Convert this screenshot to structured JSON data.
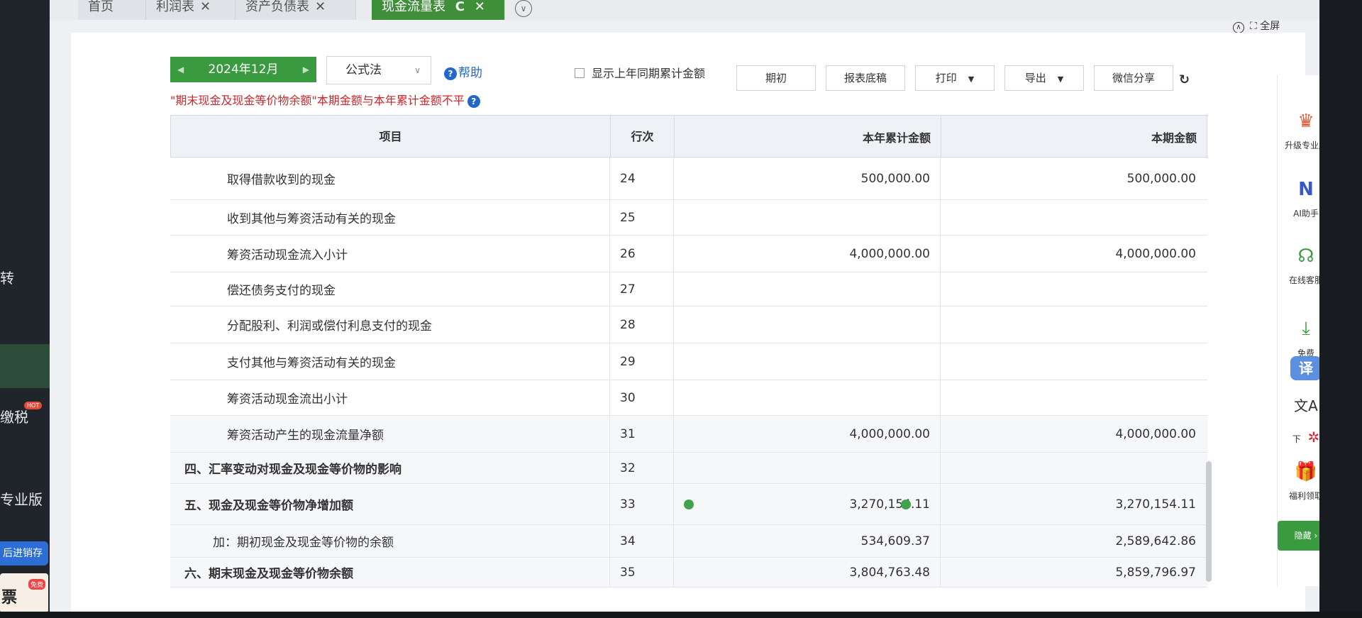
{
  "tabs": [
    {
      "label": "首页",
      "closable": false,
      "active": false
    },
    {
      "label": "利润表",
      "closable": true,
      "active": false
    },
    {
      "label": "资产负债表",
      "closable": true,
      "active": false
    },
    {
      "label": "现金流量表",
      "closable": true,
      "active": true
    }
  ],
  "tab_close_glyph": "✕",
  "tab_refresh_glyph": "C",
  "fullscreen_label": "全屏",
  "left_strip": {
    "item_1": "转",
    "item_2": "缴税",
    "hot_badge": "HOT",
    "item_3": "专业版",
    "blue_button": "后进销存",
    "card_text": "票",
    "card_badge": "免费"
  },
  "toolbar": {
    "period": "2024年12月",
    "method": "公式法",
    "help": "帮助",
    "show_last_year": "显示上年同期累计金额",
    "btn_opening": "期初",
    "btn_draft": "报表底稿",
    "btn_print": "打印",
    "btn_export": "导出",
    "btn_wechat": "微信分享"
  },
  "warning": "\"期末现金及现金等价物余额\"本期金额与本年累计金额不平",
  "table": {
    "headers": {
      "item": "项目",
      "line": "行次",
      "ytd": "本年累计金额",
      "period": "本期金额"
    },
    "rows": [
      {
        "item": "取得借款收到的现金",
        "line": "24",
        "ytd": "500,000.00",
        "period": "500,000.00",
        "bold": false,
        "dots": false
      },
      {
        "item": "收到其他与筹资活动有关的现金",
        "line": "25",
        "ytd": "",
        "period": "",
        "bold": false,
        "dots": false
      },
      {
        "item": "筹资活动现金流入小计",
        "line": "26",
        "ytd": "4,000,000.00",
        "period": "4,000,000.00",
        "bold": false,
        "dots": false
      },
      {
        "item": "偿还债务支付的现金",
        "line": "27",
        "ytd": "",
        "period": "",
        "bold": false,
        "dots": false
      },
      {
        "item": "分配股利、利润或偿付利息支付的现金",
        "line": "28",
        "ytd": "",
        "period": "",
        "bold": false,
        "dots": false
      },
      {
        "item": "支付其他与筹资活动有关的现金",
        "line": "29",
        "ytd": "",
        "period": "",
        "bold": false,
        "dots": false
      },
      {
        "item": "筹资活动现金流出小计",
        "line": "30",
        "ytd": "",
        "period": "",
        "bold": false,
        "dots": false
      },
      {
        "item": "筹资活动产生的现金流量净额",
        "line": "31",
        "ytd": "4,000,000.00",
        "period": "4,000,000.00",
        "bold": false,
        "dots": false
      },
      {
        "item": "四、汇率变动对现金及现金等价物的影响",
        "line": "32",
        "ytd": "",
        "period": "",
        "bold": true,
        "dots": false
      },
      {
        "item": "五、现金及现金等价物净增加额",
        "line": "33",
        "ytd": "3,270,154.11",
        "period": "3,270,154.11",
        "bold": true,
        "dots": true
      },
      {
        "item": "加：期初现金及现金等价物的余额",
        "line": "34",
        "ytd": "534,609.37",
        "period": "2,589,642.86",
        "bold": false,
        "dots": false
      },
      {
        "item": "六、期末现金及现金等价物余额",
        "line": "35",
        "ytd": "3,804,763.48",
        "period": "5,859,796.97",
        "bold": true,
        "dots": false
      }
    ]
  },
  "sidebar": {
    "upgrade": "升级专业版",
    "ai": "AI助手",
    "service": "在线客服",
    "free": "免费",
    "translate": "译",
    "download": "下",
    "welfare": "福利领取",
    "green_btn": "隐藏"
  },
  "colors": {
    "accent_green": "#3a9a3f",
    "warning_red": "#c8282d",
    "link_blue": "#2367c9"
  }
}
